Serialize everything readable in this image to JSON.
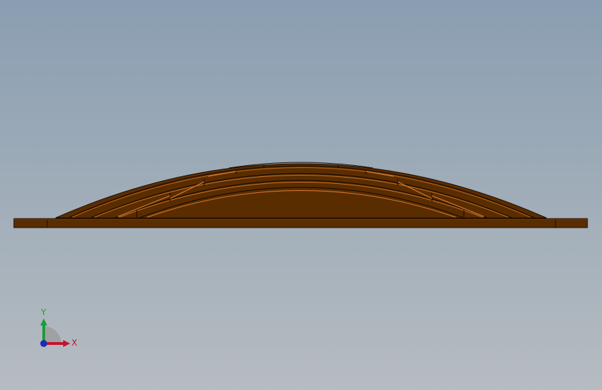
{
  "viewport": {
    "background_top": "#8a9eb1",
    "background_bottom": "#b6bcc1"
  },
  "model": {
    "part_color": "#5a2d00",
    "edge_color": "#1c0c00",
    "highlight_color": "#c8702a"
  },
  "triad": {
    "x_label": "X",
    "y_label": "Y",
    "x_color": "#c8102e",
    "y_color": "#1e9a3a",
    "z_color": "#1a2fb0"
  }
}
